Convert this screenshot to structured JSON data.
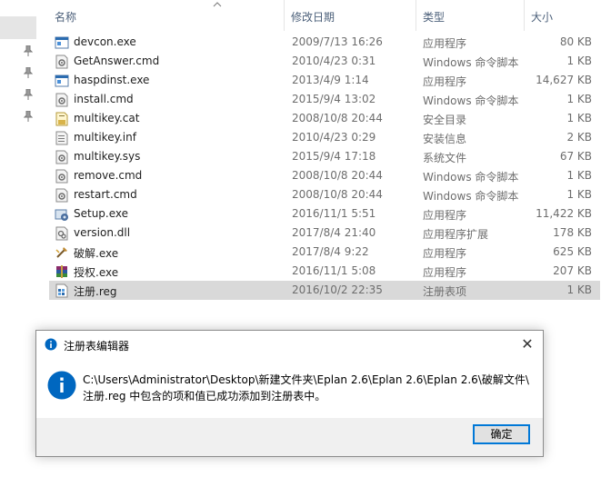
{
  "columns": {
    "name": "名称",
    "date": "修改日期",
    "type": "类型",
    "size": "大小"
  },
  "files": [
    {
      "name": "devcon.exe",
      "date": "2009/7/13 16:26",
      "type": "应用程序",
      "size": "80 KB",
      "icon": "exe-window-icon"
    },
    {
      "name": "GetAnswer.cmd",
      "date": "2010/4/23 0:31",
      "type": "Windows 命令脚本",
      "size": "1 KB",
      "icon": "cmd-gear-icon"
    },
    {
      "name": "haspdinst.exe",
      "date": "2013/4/9 1:14",
      "type": "应用程序",
      "size": "14,627 KB",
      "icon": "exe-window-icon"
    },
    {
      "name": "install.cmd",
      "date": "2015/9/4 13:02",
      "type": "Windows 命令脚本",
      "size": "1 KB",
      "icon": "cmd-gear-icon"
    },
    {
      "name": "multikey.cat",
      "date": "2008/10/8 20:44",
      "type": "安全目录",
      "size": "1 KB",
      "icon": "catalog-icon"
    },
    {
      "name": "multikey.inf",
      "date": "2010/4/23 0:29",
      "type": "安装信息",
      "size": "2 KB",
      "icon": "inf-icon"
    },
    {
      "name": "multikey.sys",
      "date": "2015/9/4 17:18",
      "type": "系统文件",
      "size": "67 KB",
      "icon": "sys-gear-icon"
    },
    {
      "name": "remove.cmd",
      "date": "2008/10/8 20:44",
      "type": "Windows 命令脚本",
      "size": "1 KB",
      "icon": "cmd-gear-icon"
    },
    {
      "name": "restart.cmd",
      "date": "2008/10/8 20:44",
      "type": "Windows 命令脚本",
      "size": "1 KB",
      "icon": "cmd-gear-icon"
    },
    {
      "name": "Setup.exe",
      "date": "2016/11/1 5:51",
      "type": "应用程序",
      "size": "11,422 KB",
      "icon": "setup-icon"
    },
    {
      "name": "version.dll",
      "date": "2017/8/4 21:40",
      "type": "应用程序扩展",
      "size": "178 KB",
      "icon": "dll-gear-icon"
    },
    {
      "name": "破解.exe",
      "date": "2017/8/4 9:22",
      "type": "应用程序",
      "size": "625 KB",
      "icon": "crack-tool-icon"
    },
    {
      "name": "授权.exe",
      "date": "2016/11/1 5:08",
      "type": "应用程序",
      "size": "207 KB",
      "icon": "winrar-icon"
    },
    {
      "name": "注册.reg",
      "date": "2016/10/2 22:35",
      "type": "注册表项",
      "size": "1 KB",
      "icon": "reg-icon",
      "selected": true
    }
  ],
  "dialog": {
    "title": "注册表编辑器",
    "close_glyph": "✕",
    "message_line1": "C:\\Users\\Administrator\\Desktop\\新建文件夹\\Eplan 2.6\\Eplan 2.6\\Eplan 2.6\\破解文件\\",
    "message_line2": "注册.reg 中包含的项和值已成功添加到注册表中。",
    "ok_label": "确定"
  },
  "colors": {
    "accent": "#0078d7",
    "header_text": "#4c607a",
    "selected_row": "#d9d9d9",
    "annotation_arrow": "#e02020"
  }
}
